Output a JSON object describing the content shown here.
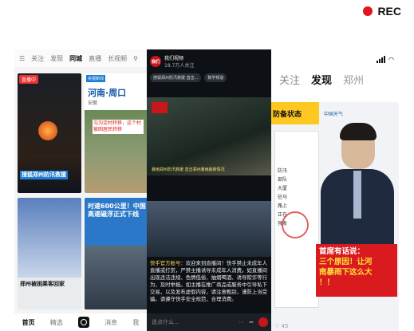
{
  "rec_label": "REC",
  "left_phone": {
    "top_nav": [
      "关注",
      "发现",
      "同城",
      "直播",
      "长视频"
    ],
    "tiles": {
      "t1": {
        "badge": "直播中",
        "caption": "搜狐郑州防汛救援"
      },
      "t2": {
        "tag": "央视新闻",
        "title": "河南·周口",
        "sub": "安徽",
        "label": "屯沟淀村转移，这个村被困居民转移"
      },
      "t3": {
        "caption": "郑州被困乘客回家"
      },
      "t4": {
        "caption": "时速600公里！中国高速磁浮正式下线"
      }
    },
    "bottom_nav": [
      "首页",
      "精选",
      "消息",
      "我"
    ]
  },
  "middle_phone": {
    "account": "我们视频",
    "followers": "18.7万人关注",
    "tags": [
      "搜狐郑州防汛救援 直击...",
      "数学频道"
    ],
    "video_caption": "暴雨郑州防汛救援 直击郑州暴雨最新情况",
    "notice_lead": "快手官方账号：",
    "notice_text": "欢迎来到直播间！快手禁止未成年人直播或打赏，严禁主播诱导未成年人消费。如直播间出现违法违规、色情低俗、抽烟喝酒、诱导欺诈等行为，及时举报。如主播在推广商品或服务中引导私下交易，以及发布虚假内容，请注意甄别，谨防上当受骗。请遵守快手安全规范，合理消费。",
    "comment_placeholder": "说点什么...",
    "logo_text": "我们"
  },
  "right_phone": {
    "tabs": [
      "关注",
      "发现",
      "郑州"
    ],
    "banner": "防备状态",
    "cma": "中国天气",
    "doc_lines": [
      "防汛",
      "部队",
      "大厦",
      "驻马",
      "路上",
      "正在",
      "强发"
    ],
    "redbox_lines": [
      "首席有话说：",
      "三个原因！让河",
      "南暴雨下这么大"
    ],
    "redbox_tail": "！！",
    "likes": "45"
  }
}
